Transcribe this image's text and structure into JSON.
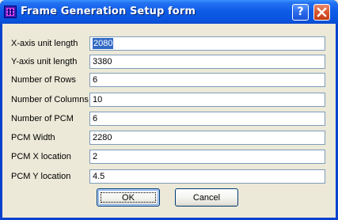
{
  "window": {
    "title": "Frame Generation Setup form",
    "help_label": "?",
    "colors": {
      "titlebar": "#0A55E0",
      "face": "#ECE9D8",
      "close": "#D9572E",
      "selection": "#316AC5"
    }
  },
  "form": {
    "fields": [
      {
        "label": "X-axis unit length",
        "value": "2080"
      },
      {
        "label": "Y-axis unit length",
        "value": "3380"
      },
      {
        "label": "Number of Rows",
        "value": "6"
      },
      {
        "label": "Number of Columns",
        "value": "10"
      },
      {
        "label": "Number of PCM",
        "value": "6"
      },
      {
        "label": "PCM Width",
        "value": "2280"
      },
      {
        "label": "PCM X location",
        "value": "2"
      },
      {
        "label": "PCM Y location",
        "value": "4.5"
      }
    ]
  },
  "buttons": {
    "ok": "OK",
    "cancel": "Cancel"
  }
}
